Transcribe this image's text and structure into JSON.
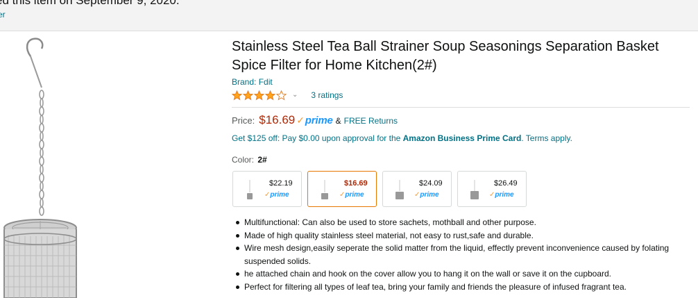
{
  "banner": {
    "text": "ed this item on September 9, 2020.",
    "link": "er"
  },
  "product": {
    "title": "Stainless Steel Tea Ball Strainer Soup Seasonings Separation Basket Spice Filter for Home Kitchen(2#)",
    "brand": "Brand: Fdit",
    "rating_stars": 4,
    "ratings_text": "3 ratings",
    "price_label": "Price:",
    "price": "$16.69",
    "prime_text": "prime",
    "amp": "&",
    "free_returns": "FREE Returns",
    "business_offer_prefix": "Get $125 off: Pay $0.00 upon approval for the ",
    "business_card": "Amazon Business Prime Card",
    "business_suffix": ". Terms apply.",
    "color_label": "Color:",
    "color_value": "2#"
  },
  "swatches": [
    {
      "price": "$22.19",
      "prime": "prime",
      "selected": false
    },
    {
      "price": "$16.69",
      "prime": "prime",
      "selected": true
    },
    {
      "price": "$24.09",
      "prime": "prime",
      "selected": false
    },
    {
      "price": "$26.49",
      "prime": "prime",
      "selected": false
    }
  ],
  "bullets": [
    "Multifunctional: Can also be used to store sachets, mothball and other purpose.",
    "Made of high quality stainless steel material, not easy to rust,safe and durable.",
    "Wire mesh design,easily seperate the solid matter from the liquid, effectly prevent inconvenience caused by folating suspended solids.",
    "he attached chain and hook on the cover allow you to hang it on the wall or save it on the cupboard.",
    "Perfect for filtering all types of leaf tea, bring your family and friends the pleasure of infused fragrant tea."
  ],
  "colors": {
    "link": "#007185",
    "price": "#b12704",
    "prime_blue": "#1a98ff",
    "star_fill": "#ffa41c",
    "selected_border": "#e77600"
  }
}
